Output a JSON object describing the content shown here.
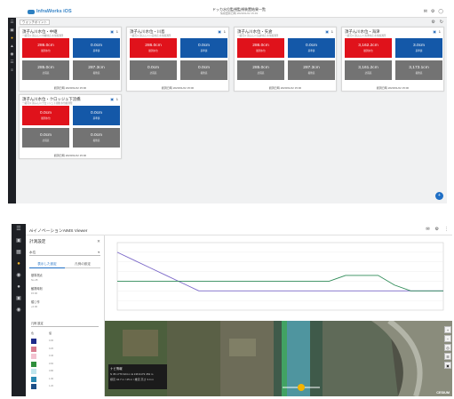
{
  "top_screen": {
    "header": {
      "brand": "InfraWorks iOS",
      "title": "ドッカ水位監視監視装置結果一覧",
      "subtitle": "情報更新日時 2020/01/22 15:49"
    },
    "tab_select": "ウォッチポイント",
    "cards": [
      {
        "title": "須子ん川水位・中継",
        "subtitle": "一級河川 須子ん川 中継地点 水位観測所",
        "badge": "1",
        "tiles": [
          {
            "value": "286.0cm",
            "label": "観測水位",
            "color": "red"
          },
          {
            "value": "0.0cm",
            "label": "基準値",
            "color": "blue"
          },
          {
            "value": "285.0cm",
            "label": "計画高",
            "color": "gray"
          },
          {
            "value": "287.3cm",
            "label": "堤防高",
            "color": "gray"
          }
        ],
        "footer": "観測日時 2020/01/22 15:00"
      },
      {
        "title": "須子ん川水位・川島",
        "subtitle": "一級河川 須子ん川 川島地点 水位観測所",
        "badge": "1",
        "tiles": [
          {
            "value": "286.0cm",
            "label": "観測水位",
            "color": "red"
          },
          {
            "value": "0.0cm",
            "label": "基準値",
            "color": "blue"
          },
          {
            "value": "0.0cm",
            "label": "計画高",
            "color": "gray"
          },
          {
            "value": "0.0cm",
            "label": "堤防高",
            "color": "gray"
          }
        ],
        "footer": "観測日時 2020/01/22 15:00"
      },
      {
        "title": "須子ん川水位・矢倉",
        "subtitle": "一級河川 須子ん川 矢倉地点 水位観測所",
        "badge": "1",
        "tiles": [
          {
            "value": "286.0cm",
            "label": "観測水位",
            "color": "red"
          },
          {
            "value": "0.0cm",
            "label": "基準値",
            "color": "blue"
          },
          {
            "value": "285.0cm",
            "label": "計画高",
            "color": "gray"
          },
          {
            "value": "287.3cm",
            "label": "堤防高",
            "color": "gray"
          }
        ],
        "footer": "観測日時 2020/01/22 15:00"
      },
      {
        "title": "須子ん川水位・海津",
        "subtitle": "一級河川 須子ん川 海津地点 水位観測所",
        "badge": "1",
        "tiles": [
          {
            "value": "3,162.2cm",
            "label": "観測水位",
            "color": "red"
          },
          {
            "value": "3.0cm",
            "label": "基準値",
            "color": "blue"
          },
          {
            "value": "3,161.2cm",
            "label": "計画高",
            "color": "gray"
          },
          {
            "value": "3,173.1cm",
            "label": "堤防高",
            "color": "gray"
          }
        ],
        "footer": "観測日時 2020/01/22 15:00"
      },
      {
        "title": "須子ん川水位・クロッジュ下流橋",
        "subtitle": "一級河川 須子ん川 クロッジュ下流橋 水位観測所",
        "badge": "1",
        "tiles": [
          {
            "value": "0.0cm",
            "label": "観測水位",
            "color": "red"
          },
          {
            "value": "0.0cm",
            "label": "基準値",
            "color": "blue"
          },
          {
            "value": "0.0cm",
            "label": "計画高",
            "color": "gray"
          },
          {
            "value": "0.0cm",
            "label": "堤防高",
            "color": "gray"
          }
        ],
        "footer": "観測日時 2020/01/22 15:00"
      }
    ],
    "fab_label": "+"
  },
  "bottom_screen": {
    "header": {
      "title": "AiイノベーションAIMS Viewer"
    },
    "panel": {
      "title": "計測設定",
      "select_value": "水位",
      "tabs": [
        "表示した設定",
        "凡例の設定"
      ],
      "fields": [
        {
          "label": "基準測点",
          "value": "No.45"
        },
        {
          "label": "観測時刻",
          "value": "15:00"
        },
        {
          "label": "縦じ作",
          "value": "+0.00"
        }
      ],
      "select2": "凡例 設定",
      "legend_header": [
        "色",
        "値"
      ],
      "legend": [
        {
          "color": "#1e2b8a",
          "text": "0.00"
        },
        {
          "color": "#d77b8e",
          "text": "0.20"
        },
        {
          "color": "#f3c2d0",
          "text": "0.40"
        },
        {
          "color": "#2f8f3c",
          "text": "0.60"
        },
        {
          "color": "#bfe5ec",
          "text": "0.80"
        },
        {
          "color": "#2a8ab3",
          "text": "1.00"
        },
        {
          "color": "#1c4f87",
          "text": "1.20"
        }
      ]
    },
    "map": {
      "info_title": "ナビ情報",
      "info_line1": "N 35.1776 924 m  E 136.9173 454 m",
      "info_line2": "標高 44.7 m / 25 m / 推定 高さ 3.4 m",
      "attribution": "CESIUM"
    }
  },
  "chart_data": {
    "type": "line",
    "x": [
      0,
      1,
      2,
      3,
      4,
      5,
      6,
      7,
      8,
      9,
      10,
      11,
      12,
      13,
      14,
      15,
      16,
      17,
      18,
      19,
      20
    ],
    "series": [
      {
        "color": "#7b68c8",
        "values": [
          6.0,
          5.2,
          4.4,
          3.6,
          2.8,
          2.0,
          2.0,
          2.0,
          2.0,
          2.0,
          2.0,
          2.0,
          2.0,
          2.0,
          2.0,
          2.0,
          2.0,
          2.0,
          2.0,
          2.0,
          2.0
        ]
      },
      {
        "color": "#2e8b57",
        "values": [
          3.0,
          3.0,
          3.0,
          3.0,
          3.0,
          3.0,
          3.0,
          3.0,
          3.0,
          3.0,
          3.0,
          3.0,
          3.0,
          3.0,
          3.6,
          3.6,
          3.6,
          2.6,
          2.0,
          2.0,
          2.0
        ]
      }
    ],
    "ylim": [
      0,
      7
    ],
    "grid": true
  }
}
